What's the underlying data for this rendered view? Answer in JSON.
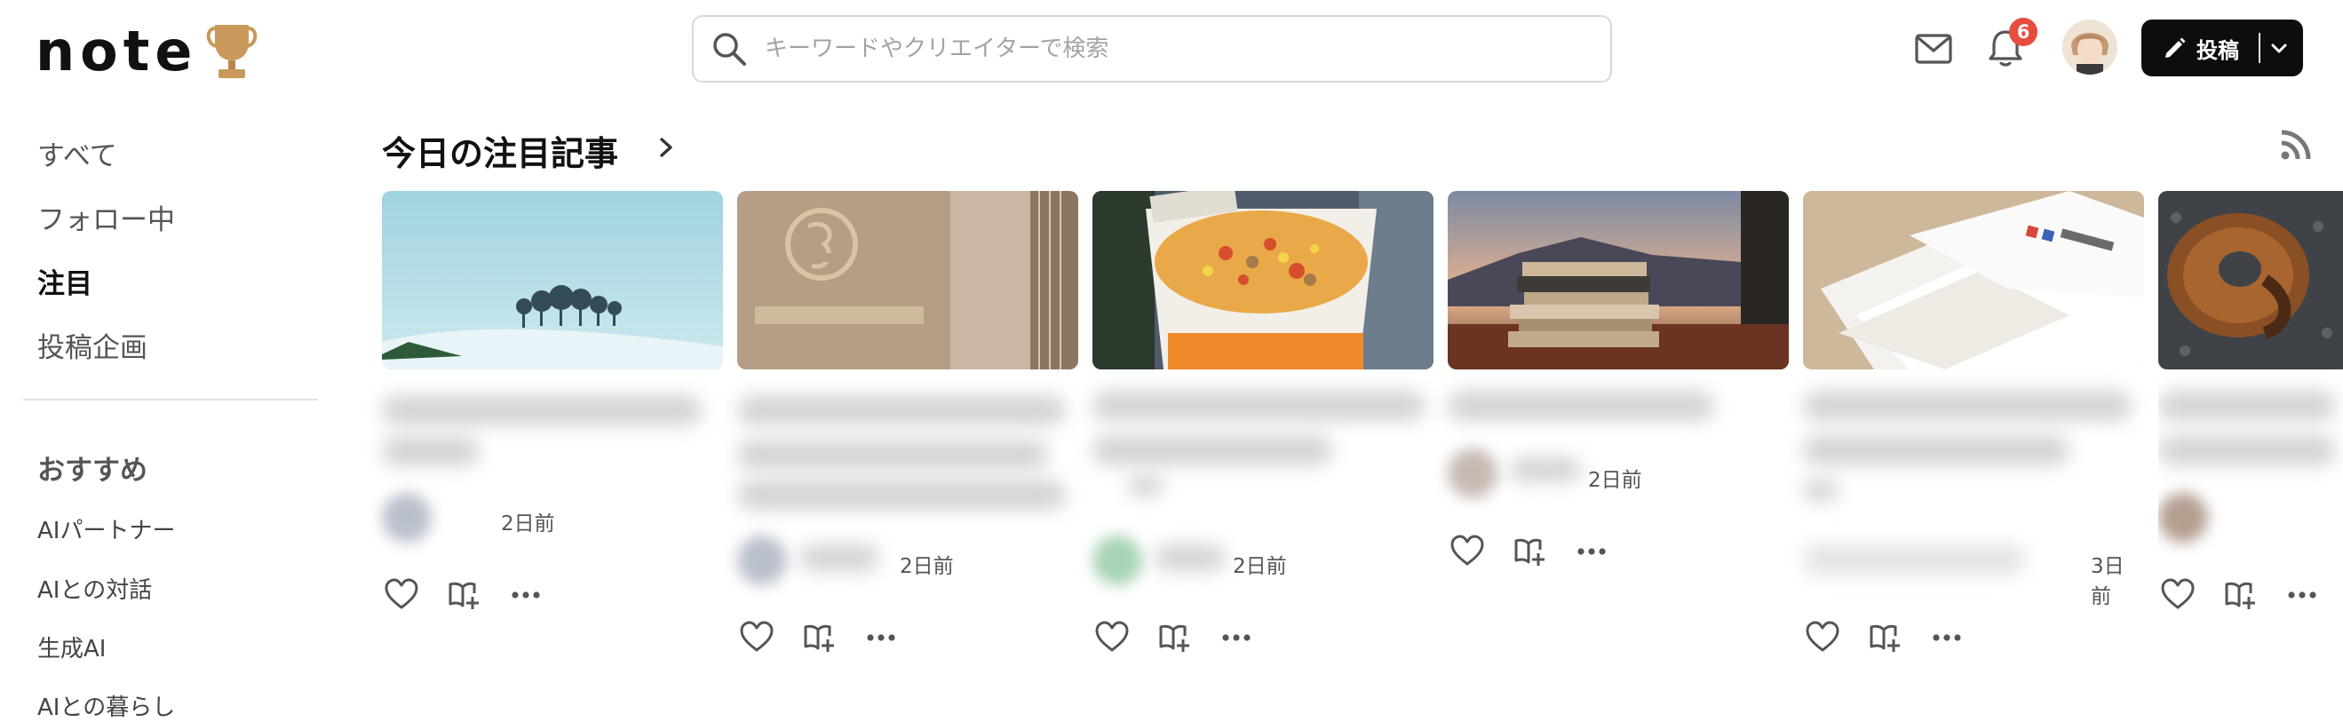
{
  "header": {
    "logo_text": "note",
    "search_placeholder": "キーワードやクリエイターで検索",
    "notification_count": "6",
    "post_button_label": "投稿"
  },
  "sidebar": {
    "nav": [
      {
        "label": "すべて"
      },
      {
        "label": "フォロー中"
      },
      {
        "label": "注目",
        "active": true
      },
      {
        "label": "投稿企画"
      }
    ],
    "recommend_heading": "おすすめ",
    "recommend": [
      {
        "label": "AIパートナー"
      },
      {
        "label": "AIとの対話"
      },
      {
        "label": "生成AI"
      },
      {
        "label": "AIとの暮らし"
      }
    ]
  },
  "main": {
    "section_title": "今日の注目記事",
    "cards": [
      {
        "thumb": "snowy-trees",
        "time": "2日前"
      },
      {
        "thumb": "jal-lounge-sign",
        "time": "2日前"
      },
      {
        "thumb": "cup-noodle",
        "time": "2日前"
      },
      {
        "thumb": "books-window-sunset",
        "time": "2日前"
      },
      {
        "thumb": "papers-with-text",
        "time": "3日前"
      },
      {
        "thumb": "donut",
        "time": ""
      }
    ]
  },
  "colors": {
    "accent_dark": "#0d0d0d",
    "badge": "#e74c3c",
    "text_primary": "#111111",
    "text_secondary": "#555555"
  }
}
